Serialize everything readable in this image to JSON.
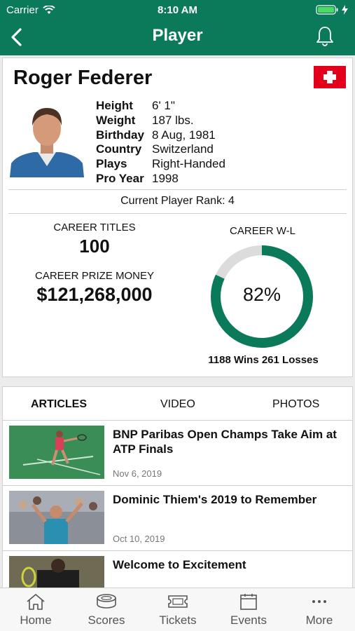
{
  "status_bar": {
    "carrier": "Carrier",
    "time": "8:10 AM"
  },
  "header": {
    "title": "Player"
  },
  "player": {
    "name": "Roger Federer",
    "info": [
      {
        "label": "Height",
        "value": "6' 1\""
      },
      {
        "label": "Weight",
        "value": "187 lbs."
      },
      {
        "label": "Birthday",
        "value": "8 Aug, 1981"
      },
      {
        "label": "Country",
        "value": "Switzerland"
      },
      {
        "label": "Plays",
        "value": "Right-Handed"
      },
      {
        "label": "Pro Year",
        "value": "1998"
      }
    ],
    "rank_text": "Current Player Rank: 4",
    "career_titles_label": "CAREER TITLES",
    "career_titles": "100",
    "prize_money_label": "CAREER PRIZE MONEY",
    "prize_money": "$121,268,000",
    "wl_label": "CAREER W-L",
    "win_pct": 82,
    "win_pct_text": "82%",
    "record_text": "1188 Wins 261 Losses"
  },
  "colors": {
    "brand": "#0b7a5b",
    "ring_track": "#dcdcdc"
  },
  "news_tabs": [
    {
      "label": "ARTICLES",
      "active": true
    },
    {
      "label": "VIDEO",
      "active": false
    },
    {
      "label": "PHOTOS",
      "active": false
    }
  ],
  "articles": [
    {
      "title": "BNP Paribas Open Champs Take Aim at ATP Finals",
      "date": "Nov 6, 2019"
    },
    {
      "title": "Dominic Thiem's 2019 to Remember",
      "date": "Oct 10, 2019"
    },
    {
      "title": "Welcome to Excitement",
      "date": ""
    }
  ],
  "tab_bar": [
    {
      "label": "Home",
      "icon": "home-icon"
    },
    {
      "label": "Scores",
      "icon": "scores-icon"
    },
    {
      "label": "Tickets",
      "icon": "ticket-icon"
    },
    {
      "label": "Events",
      "icon": "calendar-icon"
    },
    {
      "label": "More",
      "icon": "more-icon"
    }
  ]
}
